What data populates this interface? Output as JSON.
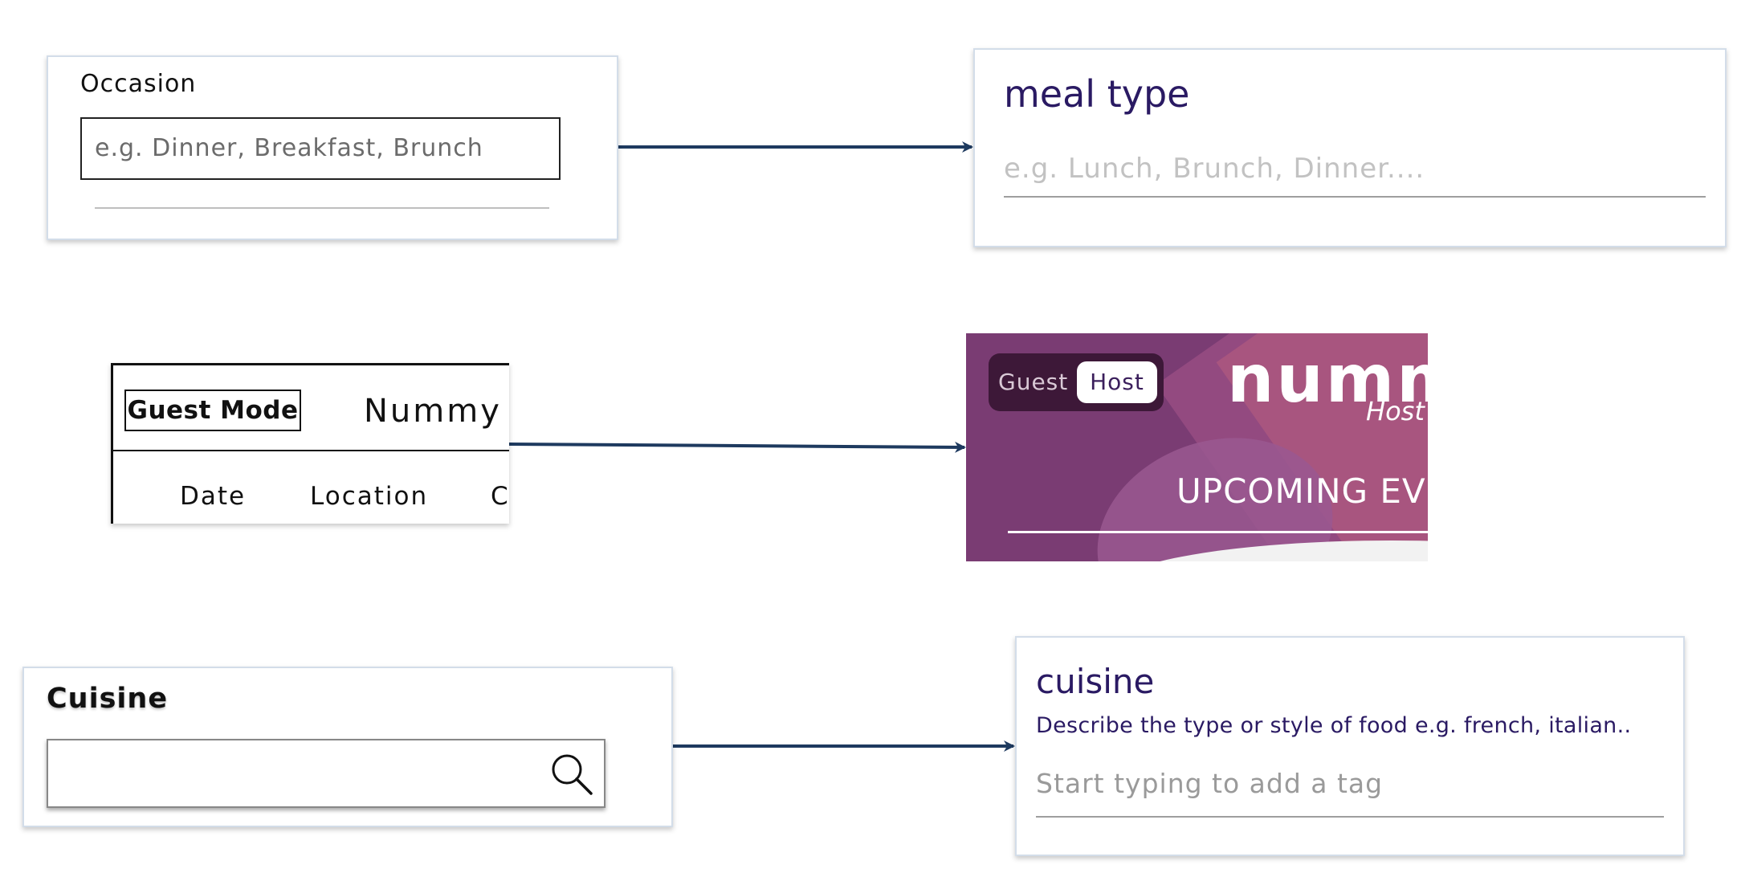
{
  "occasion_old": {
    "label": "Occasion",
    "placeholder": "e.g. Dinner, Breakfast, Brunch"
  },
  "meal_type_new": {
    "label": "meal type",
    "placeholder": "e.g. Lunch, Brunch, Dinner...."
  },
  "guest_header_old": {
    "mode_label": "Guest Mode",
    "brand": "Nummy",
    "nav": [
      "Date",
      "Location",
      "C"
    ]
  },
  "host_banner_new": {
    "toggle_guest": "Guest",
    "toggle_host": "Host",
    "logo": "numm",
    "logo_sub": "Host",
    "heading": "UPCOMING EVI",
    "colors": {
      "background": "#7a3c73",
      "toggle_bg": "#3d1838"
    }
  },
  "cuisine_old": {
    "label": "Cuisine",
    "search_icon": "search-icon"
  },
  "cuisine_new": {
    "label": "cuisine",
    "description": "Describe the type or style of food e.g. french, italian..",
    "placeholder": "Start typing to add a tag"
  },
  "colors": {
    "arrow": "#1e3a5f",
    "label_new": "#2a1a63",
    "card_border": "#d3dde9"
  }
}
